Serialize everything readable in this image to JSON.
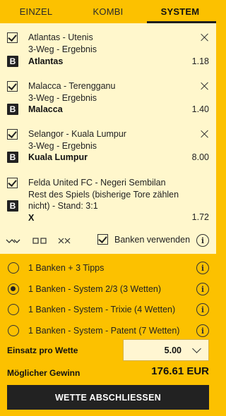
{
  "tabs": [
    {
      "label": "EINZEL",
      "active": false
    },
    {
      "label": "KOMBI",
      "active": false
    },
    {
      "label": "SYSTEM",
      "active": true
    }
  ],
  "bank_badge": "B",
  "bets": [
    {
      "match": "Atlantas - Utenis",
      "market": "3-Weg - Ergebnis",
      "pick": "Atlantas",
      "odds": "1.18"
    },
    {
      "match": "Malacca - Terengganu",
      "market": "3-Weg - Ergebnis",
      "pick": "Malacca",
      "odds": "1.40"
    },
    {
      "match": "Selangor - Kuala Lumpur",
      "market": "3-Weg - Ergebnis",
      "pick": "Kuala Lumpur",
      "odds": "8.00"
    },
    {
      "match": "Felda United FC - Negeri Sembilan",
      "market_lines": [
        "Rest des Spiels (bisherige Tore zählen",
        "nicht) - Stand: 3:1"
      ],
      "pick": "X",
      "odds": "1.72"
    }
  ],
  "filters": {
    "banks_label": "Banken verwenden"
  },
  "info_glyph": "i",
  "system_options": [
    {
      "label": "1 Banken + 3 Tipps",
      "selected": false
    },
    {
      "label": "1 Banken - System 2/3 (3 Wetten)",
      "selected": true
    },
    {
      "label": "1 Banken - System - Trixie (4 Wetten)",
      "selected": false
    },
    {
      "label": "1 Banken - System - Patent (7 Wetten)",
      "selected": false
    }
  ],
  "stake": {
    "label": "Einsatz pro Wette",
    "value": "5.00"
  },
  "winnings": {
    "label": "Möglicher Gewinn",
    "value": "176.61 EUR"
  },
  "submit_label": "WETTE ABSCHLIESSEN",
  "colors": {
    "accent": "#fcc100",
    "panel": "#fff7cc",
    "dark": "#222222"
  }
}
